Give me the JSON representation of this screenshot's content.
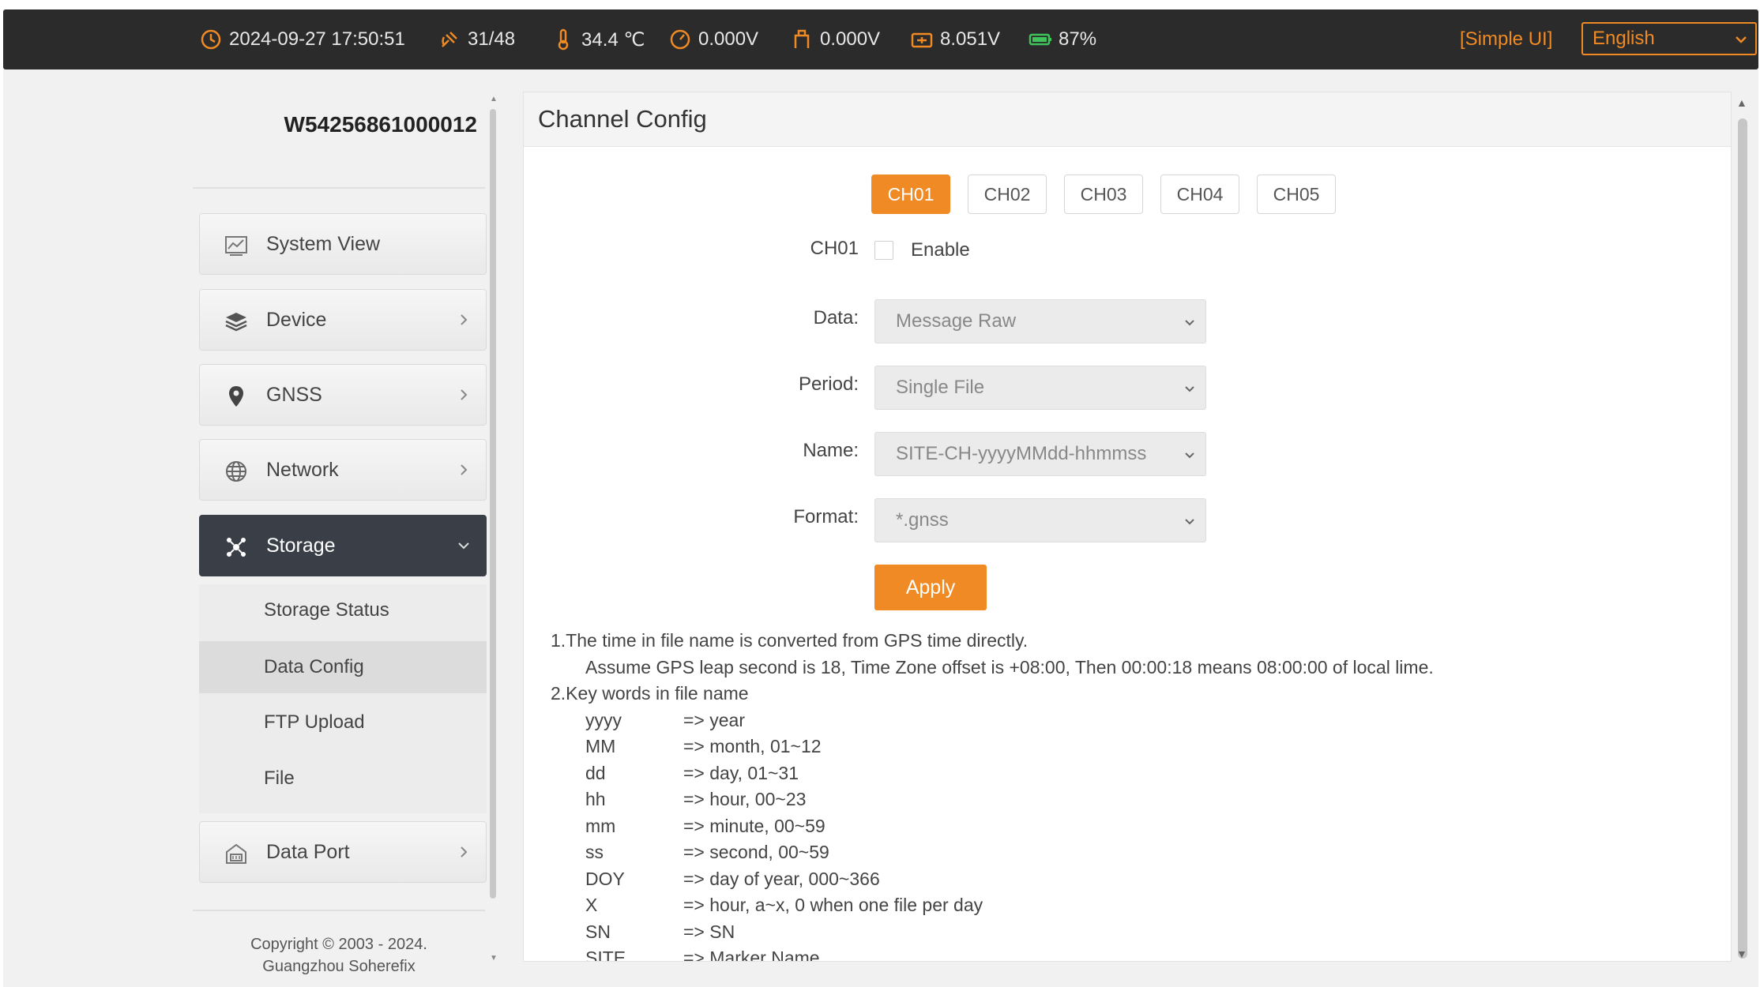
{
  "topbar": {
    "datetime": "2024-09-27 17:50:51",
    "satellites": "31/48",
    "temperature": "34.4 ℃",
    "voltage1": "0.000V",
    "voltage2": "0.000V",
    "voltage3": "8.051V",
    "battery": "87%",
    "simple_ui": "[Simple UI]",
    "language": "English"
  },
  "sidebar": {
    "serial": "W54256861000012",
    "items": [
      {
        "label": "System View",
        "icon": "chart-icon"
      },
      {
        "label": "Device",
        "icon": "layers-icon"
      },
      {
        "label": "GNSS",
        "icon": "location-pin-icon"
      },
      {
        "label": "Network",
        "icon": "globe-icon"
      },
      {
        "label": "Storage",
        "icon": "storage-icon"
      },
      {
        "label": "Data Port",
        "icon": "port-icon"
      }
    ],
    "storage_sub": [
      "Storage Status",
      "Data Config",
      "FTP Upload",
      "File"
    ],
    "selected_sub": "Data Config",
    "copyright_line1": "Copyright © 2003 - 2024.",
    "copyright_line2": "Guangzhou Soherefix"
  },
  "main": {
    "title": "Channel Config",
    "tabs": [
      "CH01",
      "CH02",
      "CH03",
      "CH04",
      "CH05"
    ],
    "active_tab": "CH01",
    "channel_label": "CH01",
    "enable_label": "Enable",
    "enabled": false,
    "fields": {
      "data": {
        "label": "Data:",
        "value": "Message Raw"
      },
      "period": {
        "label": "Period:",
        "value": "Single File"
      },
      "name": {
        "label": "Name:",
        "value": "SITE-CH-yyyyMMdd-hhmmss"
      },
      "format": {
        "label": "Format:",
        "value": "*.gnss"
      }
    },
    "apply_label": "Apply",
    "notes": {
      "line1": "1.The time in file name is converted from GPS time directly.",
      "line2": "Assume GPS leap second is 18, Time Zone offset is +08:00, Then 00:00:18 means 08:00:00 of local lime.",
      "line3": "2.Key words in file name",
      "keywords": [
        {
          "key": "yyyy",
          "desc": "=> year"
        },
        {
          "key": "MM",
          "desc": "=> month, 01~12"
        },
        {
          "key": "dd",
          "desc": "=> day, 01~31"
        },
        {
          "key": "hh",
          "desc": "=> hour, 00~23"
        },
        {
          "key": "mm",
          "desc": "=> minute, 00~59"
        },
        {
          "key": "ss",
          "desc": "=> second, 00~59"
        },
        {
          "key": "DOY",
          "desc": "=> day of year, 000~366"
        },
        {
          "key": "X",
          "desc": "=> hour, a~x, 0 when one file per day"
        },
        {
          "key": "SN",
          "desc": "=> SN"
        },
        {
          "key": "SITE",
          "desc": "=> Marker Name"
        }
      ]
    }
  },
  "colors": {
    "accent": "#f08a24",
    "topbar": "#2b2b2b",
    "active_nav": "#3a3f47"
  }
}
